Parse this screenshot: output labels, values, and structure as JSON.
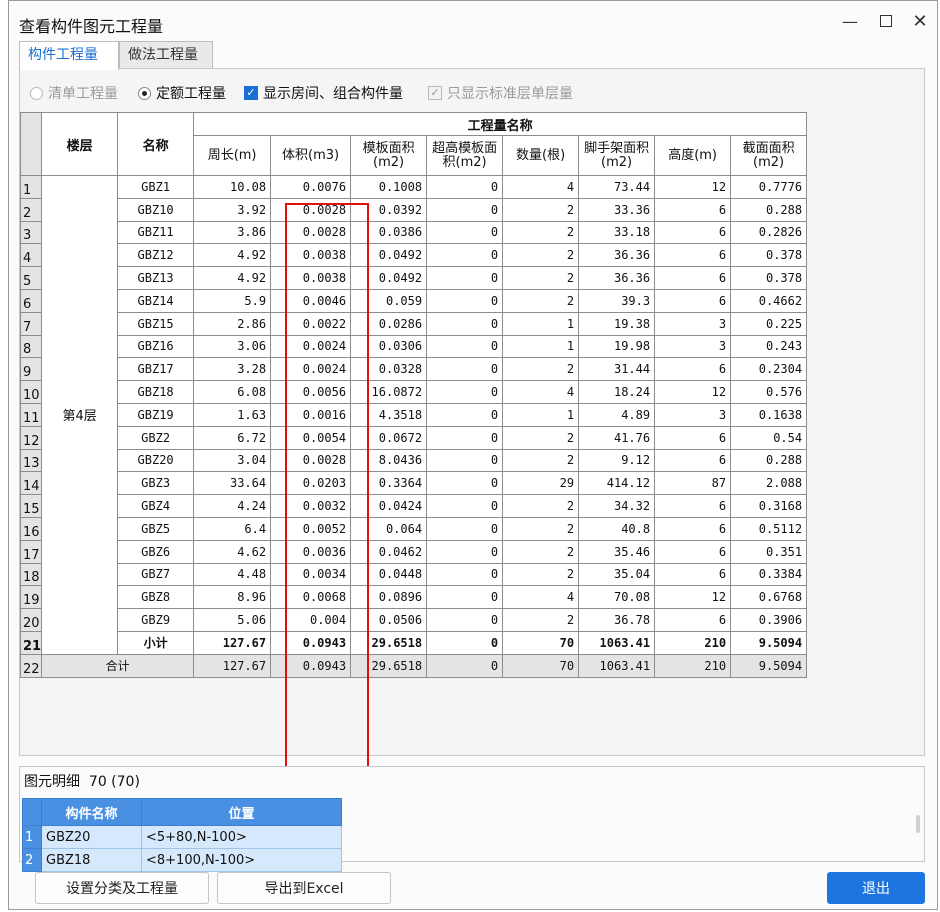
{
  "window": {
    "title": "查看构件图元工程量"
  },
  "tabs": [
    {
      "label": "构件工程量"
    },
    {
      "label": "做法工程量"
    }
  ],
  "options": {
    "bill_qty": "清单工程量",
    "quota_qty": "定额工程量",
    "show_rooms": "显示房间、组合构件量",
    "std_floor_only": "只显示标准层单层量"
  },
  "colors": {
    "accent": "#1a6fd6",
    "highlight_box": "#e01010",
    "detail_header": "#4a90e2",
    "exit_button": "#1f75e0"
  },
  "chart_data": {
    "type": "table",
    "group_header": "工程量名称",
    "headers": {
      "floor": "楼层",
      "name": "名称",
      "columns": [
        "周长(m)",
        "体积(m3)",
        "模板面积(m2)",
        "超高模板面积(m2)",
        "数量(根)",
        "脚手架面积(m2)",
        "高度(m)",
        "截面面积(m2)"
      ]
    },
    "floor": "第4层",
    "rows": [
      {
        "n": "1",
        "name": "GBZ1",
        "v": [
          "10.08",
          "0.0076",
          "0.1008",
          "0",
          "4",
          "73.44",
          "12",
          "0.7776"
        ]
      },
      {
        "n": "2",
        "name": "GBZ10",
        "v": [
          "3.92",
          "0.0028",
          "0.0392",
          "0",
          "2",
          "33.36",
          "6",
          "0.288"
        ]
      },
      {
        "n": "3",
        "name": "GBZ11",
        "v": [
          "3.86",
          "0.0028",
          "0.0386",
          "0",
          "2",
          "33.18",
          "6",
          "0.2826"
        ]
      },
      {
        "n": "4",
        "name": "GBZ12",
        "v": [
          "4.92",
          "0.0038",
          "0.0492",
          "0",
          "2",
          "36.36",
          "6",
          "0.378"
        ]
      },
      {
        "n": "5",
        "name": "GBZ13",
        "v": [
          "4.92",
          "0.0038",
          "0.0492",
          "0",
          "2",
          "36.36",
          "6",
          "0.378"
        ]
      },
      {
        "n": "6",
        "name": "GBZ14",
        "v": [
          "5.9",
          "0.0046",
          "0.059",
          "0",
          "2",
          "39.3",
          "6",
          "0.4662"
        ]
      },
      {
        "n": "7",
        "name": "GBZ15",
        "v": [
          "2.86",
          "0.0022",
          "0.0286",
          "0",
          "1",
          "19.38",
          "3",
          "0.225"
        ]
      },
      {
        "n": "8",
        "name": "GBZ16",
        "v": [
          "3.06",
          "0.0024",
          "0.0306",
          "0",
          "1",
          "19.98",
          "3",
          "0.243"
        ]
      },
      {
        "n": "9",
        "name": "GBZ17",
        "v": [
          "3.28",
          "0.0024",
          "0.0328",
          "0",
          "2",
          "31.44",
          "6",
          "0.2304"
        ]
      },
      {
        "n": "10",
        "name": "GBZ18",
        "v": [
          "6.08",
          "0.0056",
          "16.0872",
          "0",
          "4",
          "18.24",
          "12",
          "0.576"
        ]
      },
      {
        "n": "11",
        "name": "GBZ19",
        "v": [
          "1.63",
          "0.0016",
          "4.3518",
          "0",
          "1",
          "4.89",
          "3",
          "0.1638"
        ]
      },
      {
        "n": "12",
        "name": "GBZ2",
        "v": [
          "6.72",
          "0.0054",
          "0.0672",
          "0",
          "2",
          "41.76",
          "6",
          "0.54"
        ]
      },
      {
        "n": "13",
        "name": "GBZ20",
        "v": [
          "3.04",
          "0.0028",
          "8.0436",
          "0",
          "2",
          "9.12",
          "6",
          "0.288"
        ]
      },
      {
        "n": "14",
        "name": "GBZ3",
        "v": [
          "33.64",
          "0.0203",
          "0.3364",
          "0",
          "29",
          "414.12",
          "87",
          "2.088"
        ]
      },
      {
        "n": "15",
        "name": "GBZ4",
        "v": [
          "4.24",
          "0.0032",
          "0.0424",
          "0",
          "2",
          "34.32",
          "6",
          "0.3168"
        ]
      },
      {
        "n": "16",
        "name": "GBZ5",
        "v": [
          "6.4",
          "0.0052",
          "0.064",
          "0",
          "2",
          "40.8",
          "6",
          "0.5112"
        ]
      },
      {
        "n": "17",
        "name": "GBZ6",
        "v": [
          "4.62",
          "0.0036",
          "0.0462",
          "0",
          "2",
          "35.46",
          "6",
          "0.351"
        ]
      },
      {
        "n": "18",
        "name": "GBZ7",
        "v": [
          "4.48",
          "0.0034",
          "0.0448",
          "0",
          "2",
          "35.04",
          "6",
          "0.3384"
        ]
      },
      {
        "n": "19",
        "name": "GBZ8",
        "v": [
          "8.96",
          "0.0068",
          "0.0896",
          "0",
          "4",
          "70.08",
          "12",
          "0.6768"
        ]
      },
      {
        "n": "20",
        "name": "GBZ9",
        "v": [
          "5.06",
          "0.004",
          "0.0506",
          "0",
          "2",
          "36.78",
          "6",
          "0.3906"
        ]
      }
    ],
    "subtotal": {
      "n": "21",
      "label": "小计",
      "v": [
        "127.67",
        "0.0943",
        "29.6518",
        "0",
        "70",
        "1063.41",
        "210",
        "9.5094"
      ]
    },
    "total": {
      "n": "22",
      "label": "合计",
      "v": [
        "127.67",
        "0.0943",
        "29.6518",
        "0",
        "70",
        "1063.41",
        "210",
        "9.5094"
      ]
    }
  },
  "detail": {
    "title": "图元明细",
    "count": "70 (70)",
    "headers": {
      "name": "构件名称",
      "position": "位置"
    },
    "rows": [
      {
        "n": "1",
        "name": "GBZ20",
        "position": "<5+80,N-100>"
      },
      {
        "n": "2",
        "name": "GBZ18",
        "position": "<8+100,N-100>"
      }
    ]
  },
  "buttons": {
    "setup": "设置分类及工程量",
    "export": "导出到Excel",
    "exit": "退出"
  }
}
